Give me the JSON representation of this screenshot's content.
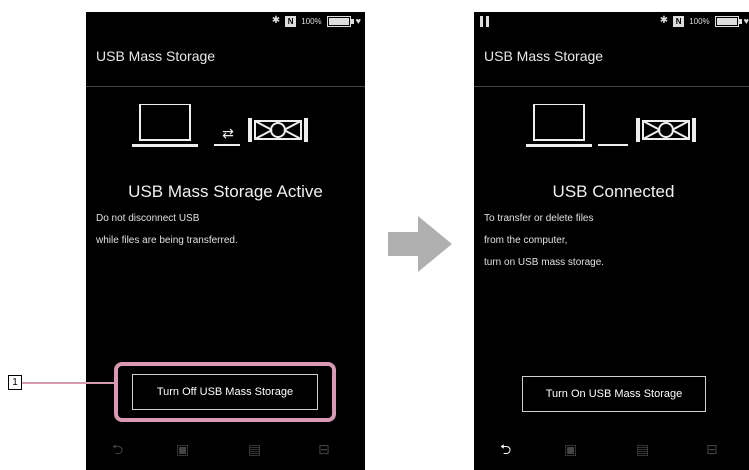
{
  "left_screen": {
    "title": "USB Mass Storage",
    "connection_symbol": "⇄",
    "heading": "USB Mass Storage Active",
    "description": [
      "Do not disconnect USB",
      "while files are being transferred."
    ],
    "button_label": "Turn Off USB Mass Storage",
    "status": {
      "battery_text": "100%"
    }
  },
  "right_screen": {
    "title": "USB Mass Storage",
    "heading": "USB Connected",
    "description": [
      "To transfer or delete files",
      "from the computer,",
      "turn on USB mass storage."
    ],
    "button_label": "Turn On USB Mass Storage",
    "status": {
      "battery_text": "100%"
    }
  },
  "callout": {
    "number": "1"
  },
  "icons": {
    "bluetooth": "bluetooth-icon",
    "nfc": "nfc-icon",
    "battery": "battery-icon",
    "headphone": "headphone-icon",
    "pause": "pause-icon",
    "back": "back-icon",
    "laptop": "laptop-icon",
    "player": "player-icon",
    "arrow": "arrow-icon"
  },
  "colors": {
    "highlight": "#d89ab2",
    "arrow": "#b0b0b0"
  }
}
